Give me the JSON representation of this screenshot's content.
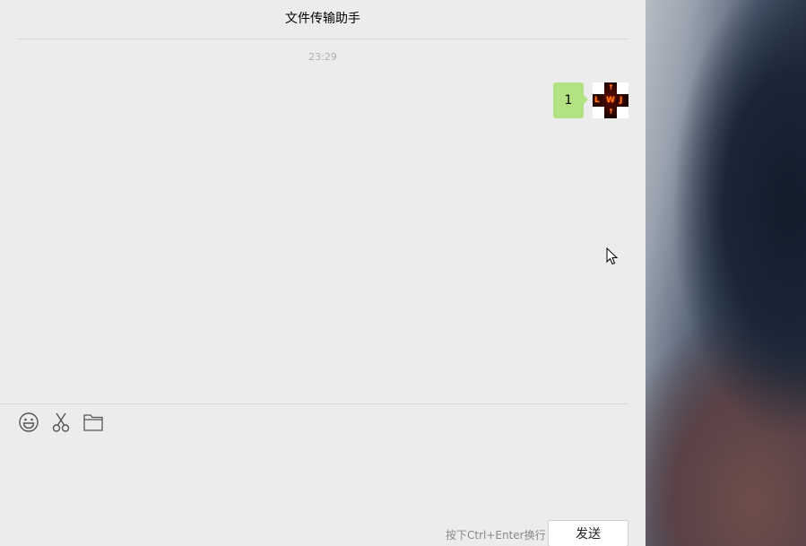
{
  "window": {
    "title": "文件传输助手"
  },
  "messages": [
    {
      "timestamp": "23:29",
      "sender": "self",
      "text": "1",
      "avatar": {
        "letters": [
          "L",
          "W",
          "J"
        ],
        "top_mark": "↑",
        "bottom_mark": "↑"
      }
    }
  ],
  "toolbar": {
    "emoji_icon": "smiley-icon",
    "screenshot_icon": "scissors-icon",
    "file_icon": "folder-icon"
  },
  "input": {
    "hint": "按下Ctrl+Enter换行",
    "send_label": "发送"
  },
  "colors": {
    "background": "#ececec",
    "bubble_self": "#b2e281",
    "divider": "#d6d6d6",
    "timestamp": "#b0b0b0"
  }
}
